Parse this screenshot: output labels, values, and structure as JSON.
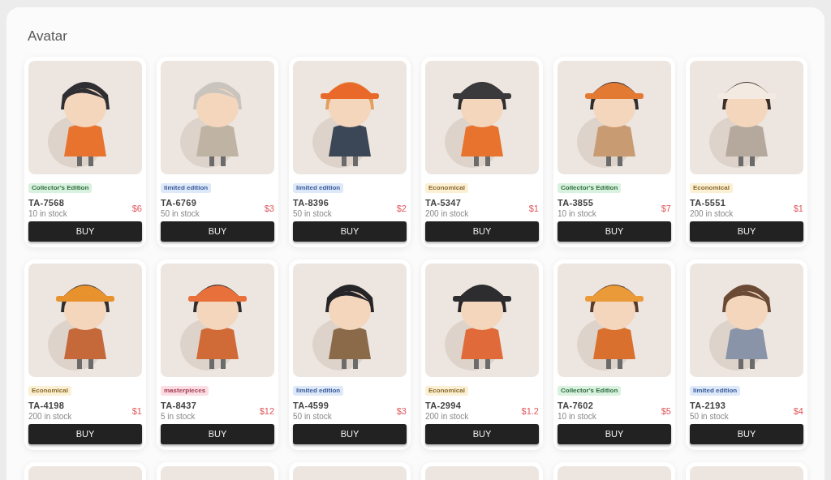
{
  "title": "Avatar",
  "products": [
    {
      "kind": "product",
      "tag": {
        "text": "Collector's Edition",
        "kind": "collector"
      },
      "name": "TA-7568",
      "stock": "10 in stock",
      "price": "$6",
      "button": "BUY"
    },
    {
      "kind": "product",
      "tag": {
        "text": "limited edition",
        "kind": "limited"
      },
      "name": "TA-6769",
      "stock": "50 in stock",
      "price": "$3",
      "button": "BUY"
    },
    {
      "kind": "product",
      "tag": {
        "text": "limited edition",
        "kind": "limited"
      },
      "name": "TA-8396",
      "stock": "50 in stock",
      "price": "$2",
      "button": "BUY"
    },
    {
      "kind": "product",
      "tag": {
        "text": "Economical",
        "kind": "economical"
      },
      "name": "TA-5347",
      "stock": "200 in stock",
      "price": "$1",
      "button": "BUY"
    },
    {
      "kind": "product",
      "tag": {
        "text": "Collector's Edition",
        "kind": "collector"
      },
      "name": "TA-3855",
      "stock": "10 in stock",
      "price": "$7",
      "button": "BUY"
    },
    {
      "kind": "product",
      "tag": {
        "text": "Economical",
        "kind": "economical"
      },
      "name": "TA-5551",
      "stock": "200 in stock",
      "price": "$1",
      "button": "BUY"
    },
    {
      "kind": "product",
      "tag": {
        "text": "Economical",
        "kind": "economical"
      },
      "name": "TA-4198",
      "stock": "200 in stock",
      "price": "$1",
      "button": "BUY"
    },
    {
      "kind": "product",
      "tag": {
        "text": "masterpieces",
        "kind": "masterpiece"
      },
      "name": "TA-8437",
      "stock": "5 in stock",
      "price": "$12",
      "button": "BUY"
    },
    {
      "kind": "product",
      "tag": {
        "text": "limited edition",
        "kind": "limited"
      },
      "name": "TA-4599",
      "stock": "50 in stock",
      "price": "$3",
      "button": "BUY"
    },
    {
      "kind": "product",
      "tag": {
        "text": "Economical",
        "kind": "economical"
      },
      "name": "TA-2994",
      "stock": "200 in stock",
      "price": "$1.2",
      "button": "BUY"
    },
    {
      "kind": "product",
      "tag": {
        "text": "Collector's Edition",
        "kind": "collector"
      },
      "name": "TA-7602",
      "stock": "10 in stock",
      "price": "$5",
      "button": "BUY"
    },
    {
      "kind": "product",
      "tag": {
        "text": "limited edition",
        "kind": "limited"
      },
      "name": "TA-2193",
      "stock": "50 in stock",
      "price": "$4",
      "button": "BUY"
    },
    {
      "kind": "picture"
    },
    {
      "kind": "picture"
    },
    {
      "kind": "picture"
    },
    {
      "kind": "picture"
    },
    {
      "kind": "picture"
    },
    {
      "kind": "picture"
    }
  ]
}
